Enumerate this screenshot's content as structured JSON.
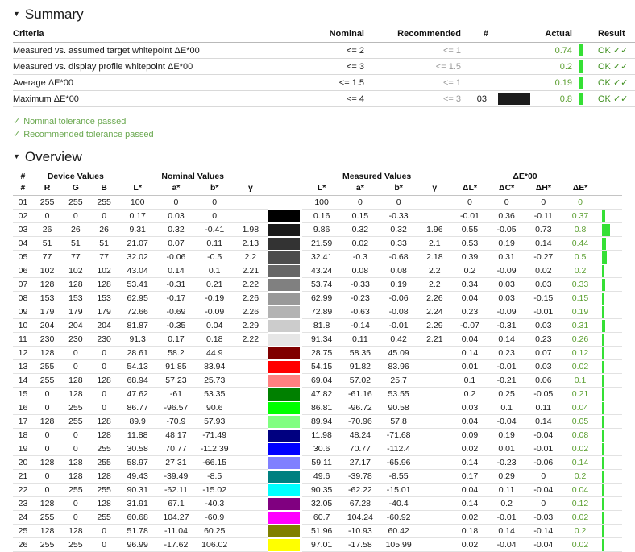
{
  "summary": {
    "heading": "Summary",
    "triangle": "▼",
    "columns": [
      "Criteria",
      "Nominal",
      "Recommended",
      "#",
      "",
      "Actual",
      "",
      "Result"
    ],
    "rows": [
      {
        "criteria": "Measured vs. assumed target whitepoint ΔE*00",
        "nominal": "<= 2",
        "recommended": "<= 1",
        "num": "",
        "swatch": "",
        "actual": "0.74",
        "bar": true,
        "result": "OK ✓✓"
      },
      {
        "criteria": "Measured vs. display profile whitepoint ΔE*00",
        "nominal": "<= 3",
        "recommended": "<= 1.5",
        "num": "",
        "swatch": "",
        "actual": "0.2",
        "bar": true,
        "result": "OK ✓✓"
      },
      {
        "criteria": "Average ΔE*00",
        "nominal": "<= 1.5",
        "recommended": "<= 1",
        "num": "",
        "swatch": "",
        "actual": "0.19",
        "bar": true,
        "result": "OK ✓✓"
      },
      {
        "criteria": "Maximum ΔE*00",
        "nominal": "<= 4",
        "recommended": "<= 3",
        "num": "03",
        "swatch": "#1c1c1c",
        "actual": "0.8",
        "bar": true,
        "result": "OK ✓✓"
      }
    ]
  },
  "notes": [
    {
      "check": "✓",
      "text": "Nominal tolerance passed"
    },
    {
      "check": "✓",
      "text": "Recommended tolerance passed"
    }
  ],
  "overview": {
    "heading": "Overview",
    "triangle": "▼",
    "group_headers": [
      "#",
      "Device Values",
      "Nominal Values",
      "",
      "Measured Values",
      "ΔE*00"
    ],
    "columns": [
      "#",
      "R",
      "G",
      "B",
      "L*",
      "a*",
      "b*",
      "γ",
      "",
      "L*",
      "a*",
      "b*",
      "γ",
      "ΔL*",
      "ΔC*",
      "ΔH*",
      "ΔE*",
      ""
    ],
    "rows": [
      {
        "idx": "01",
        "R": "255",
        "G": "255",
        "B": "255",
        "nL": "100",
        "na": "0",
        "nb": "0",
        "ng": "",
        "swatch": "",
        "mL": "100",
        "ma": "0",
        "mb": "0",
        "mg": "",
        "dL": "0",
        "dC": "0",
        "dH": "0",
        "dE": "0",
        "bar": 0
      },
      {
        "idx": "02",
        "R": "0",
        "G": "0",
        "B": "0",
        "nL": "0.17",
        "na": "0.03",
        "nb": "0",
        "ng": "",
        "swatch": "#000000",
        "mL": "0.16",
        "ma": "0.15",
        "mb": "-0.33",
        "mg": "",
        "dL": "-0.01",
        "dC": "0.36",
        "dH": "-0.11",
        "dE": "0.37",
        "bar": 0.37
      },
      {
        "idx": "03",
        "R": "26",
        "G": "26",
        "B": "26",
        "nL": "9.31",
        "na": "0.32",
        "nb": "-0.41",
        "ng": "1.98",
        "swatch": "#1a1a1a",
        "mL": "9.86",
        "ma": "0.32",
        "mb": "0.32",
        "mg": "1.96",
        "dL": "0.55",
        "dC": "-0.05",
        "dH": "0.73",
        "dE": "0.8",
        "bar": 0.8
      },
      {
        "idx": "04",
        "R": "51",
        "G": "51",
        "B": "51",
        "nL": "21.07",
        "na": "0.07",
        "nb": "0.11",
        "ng": "2.13",
        "swatch": "#333333",
        "mL": "21.59",
        "ma": "0.02",
        "mb": "0.33",
        "mg": "2.1",
        "dL": "0.53",
        "dC": "0.19",
        "dH": "0.14",
        "dE": "0.44",
        "bar": 0.44
      },
      {
        "idx": "05",
        "R": "77",
        "G": "77",
        "B": "77",
        "nL": "32.02",
        "na": "-0.06",
        "nb": "-0.5",
        "ng": "2.2",
        "swatch": "#4d4d4d",
        "mL": "32.41",
        "ma": "-0.3",
        "mb": "-0.68",
        "mg": "2.18",
        "dL": "0.39",
        "dC": "0.31",
        "dH": "-0.27",
        "dE": "0.5",
        "bar": 0.5
      },
      {
        "idx": "06",
        "R": "102",
        "G": "102",
        "B": "102",
        "nL": "43.04",
        "na": "0.14",
        "nb": "0.1",
        "ng": "2.21",
        "swatch": "#666666",
        "mL": "43.24",
        "ma": "0.08",
        "mb": "0.08",
        "mg": "2.2",
        "dL": "0.2",
        "dC": "-0.09",
        "dH": "0.02",
        "dE": "0.2",
        "bar": 0.2
      },
      {
        "idx": "07",
        "R": "128",
        "G": "128",
        "B": "128",
        "nL": "53.41",
        "na": "-0.31",
        "nb": "0.21",
        "ng": "2.22",
        "swatch": "#808080",
        "mL": "53.74",
        "ma": "-0.33",
        "mb": "0.19",
        "mg": "2.2",
        "dL": "0.34",
        "dC": "0.03",
        "dH": "0.03",
        "dE": "0.33",
        "bar": 0.33
      },
      {
        "idx": "08",
        "R": "153",
        "G": "153",
        "B": "153",
        "nL": "62.95",
        "na": "-0.17",
        "nb": "-0.19",
        "ng": "2.26",
        "swatch": "#999999",
        "mL": "62.99",
        "ma": "-0.23",
        "mb": "-0.06",
        "mg": "2.26",
        "dL": "0.04",
        "dC": "0.03",
        "dH": "-0.15",
        "dE": "0.15",
        "bar": 0.15
      },
      {
        "idx": "09",
        "R": "179",
        "G": "179",
        "B": "179",
        "nL": "72.66",
        "na": "-0.69",
        "nb": "-0.09",
        "ng": "2.26",
        "swatch": "#b3b3b3",
        "mL": "72.89",
        "ma": "-0.63",
        "mb": "-0.08",
        "mg": "2.24",
        "dL": "0.23",
        "dC": "-0.09",
        "dH": "-0.01",
        "dE": "0.19",
        "bar": 0.19
      },
      {
        "idx": "10",
        "R": "204",
        "G": "204",
        "B": "204",
        "nL": "81.87",
        "na": "-0.35",
        "nb": "0.04",
        "ng": "2.29",
        "swatch": "#cccccc",
        "mL": "81.8",
        "ma": "-0.14",
        "mb": "-0.01",
        "mg": "2.29",
        "dL": "-0.07",
        "dC": "-0.31",
        "dH": "0.03",
        "dE": "0.31",
        "bar": 0.31
      },
      {
        "idx": "11",
        "R": "230",
        "G": "230",
        "B": "230",
        "nL": "91.3",
        "na": "0.17",
        "nb": "0.18",
        "ng": "2.22",
        "swatch": "#e6e6e6",
        "mL": "91.34",
        "ma": "0.11",
        "mb": "0.42",
        "mg": "2.21",
        "dL": "0.04",
        "dC": "0.14",
        "dH": "0.23",
        "dE": "0.26",
        "bar": 0.26
      },
      {
        "idx": "12",
        "R": "128",
        "G": "0",
        "B": "0",
        "nL": "28.61",
        "na": "58.2",
        "nb": "44.9",
        "ng": "",
        "swatch": "#800000",
        "mL": "28.75",
        "ma": "58.35",
        "mb": "45.09",
        "mg": "",
        "dL": "0.14",
        "dC": "0.23",
        "dH": "0.07",
        "dE": "0.12",
        "bar": 0.12
      },
      {
        "idx": "13",
        "R": "255",
        "G": "0",
        "B": "0",
        "nL": "54.13",
        "na": "91.85",
        "nb": "83.94",
        "ng": "",
        "swatch": "#ff0000",
        "mL": "54.15",
        "ma": "91.82",
        "mb": "83.96",
        "mg": "",
        "dL": "0.01",
        "dC": "-0.01",
        "dH": "0.03",
        "dE": "0.02",
        "bar": 0.02
      },
      {
        "idx": "14",
        "R": "255",
        "G": "128",
        "B": "128",
        "nL": "68.94",
        "na": "57.23",
        "nb": "25.73",
        "ng": "",
        "swatch": "#ff8080",
        "mL": "69.04",
        "ma": "57.02",
        "mb": "25.7",
        "mg": "",
        "dL": "0.1",
        "dC": "-0.21",
        "dH": "0.06",
        "dE": "0.1",
        "bar": 0.1
      },
      {
        "idx": "15",
        "R": "0",
        "G": "128",
        "B": "0",
        "nL": "47.62",
        "na": "-61",
        "nb": "53.35",
        "ng": "",
        "swatch": "#008000",
        "mL": "47.82",
        "ma": "-61.16",
        "mb": "53.55",
        "mg": "",
        "dL": "0.2",
        "dC": "0.25",
        "dH": "-0.05",
        "dE": "0.21",
        "bar": 0.21
      },
      {
        "idx": "16",
        "R": "0",
        "G": "255",
        "B": "0",
        "nL": "86.77",
        "na": "-96.57",
        "nb": "90.6",
        "ng": "",
        "swatch": "#00ff00",
        "mL": "86.81",
        "ma": "-96.72",
        "mb": "90.58",
        "mg": "",
        "dL": "0.03",
        "dC": "0.1",
        "dH": "0.11",
        "dE": "0.04",
        "bar": 0.04
      },
      {
        "idx": "17",
        "R": "128",
        "G": "255",
        "B": "128",
        "nL": "89.9",
        "na": "-70.9",
        "nb": "57.93",
        "ng": "",
        "swatch": "#80ff80",
        "mL": "89.94",
        "ma": "-70.96",
        "mb": "57.8",
        "mg": "",
        "dL": "0.04",
        "dC": "-0.04",
        "dH": "0.14",
        "dE": "0.05",
        "bar": 0.05
      },
      {
        "idx": "18",
        "R": "0",
        "G": "0",
        "B": "128",
        "nL": "11.88",
        "na": "48.17",
        "nb": "-71.49",
        "ng": "",
        "swatch": "#000080",
        "mL": "11.98",
        "ma": "48.24",
        "mb": "-71.68",
        "mg": "",
        "dL": "0.09",
        "dC": "0.19",
        "dH": "-0.04",
        "dE": "0.08",
        "bar": 0.08
      },
      {
        "idx": "19",
        "R": "0",
        "G": "0",
        "B": "255",
        "nL": "30.58",
        "na": "70.77",
        "nb": "-112.39",
        "ng": "",
        "swatch": "#0000ff",
        "mL": "30.6",
        "ma": "70.77",
        "mb": "-112.4",
        "mg": "",
        "dL": "0.02",
        "dC": "0.01",
        "dH": "-0.01",
        "dE": "0.02",
        "bar": 0.02
      },
      {
        "idx": "20",
        "R": "128",
        "G": "128",
        "B": "255",
        "nL": "58.97",
        "na": "27.31",
        "nb": "-66.15",
        "ng": "",
        "swatch": "#8080ff",
        "mL": "59.11",
        "ma": "27.17",
        "mb": "-65.96",
        "mg": "",
        "dL": "0.14",
        "dC": "-0.23",
        "dH": "-0.06",
        "dE": "0.14",
        "bar": 0.14
      },
      {
        "idx": "21",
        "R": "0",
        "G": "128",
        "B": "128",
        "nL": "49.43",
        "na": "-39.49",
        "nb": "-8.5",
        "ng": "",
        "swatch": "#008080",
        "mL": "49.6",
        "ma": "-39.78",
        "mb": "-8.55",
        "mg": "",
        "dL": "0.17",
        "dC": "0.29",
        "dH": "0",
        "dE": "0.2",
        "bar": 0.2
      },
      {
        "idx": "22",
        "R": "0",
        "G": "255",
        "B": "255",
        "nL": "90.31",
        "na": "-62.11",
        "nb": "-15.02",
        "ng": "",
        "swatch": "#00ffff",
        "mL": "90.35",
        "ma": "-62.22",
        "mb": "-15.01",
        "mg": "",
        "dL": "0.04",
        "dC": "0.11",
        "dH": "-0.04",
        "dE": "0.04",
        "bar": 0.04
      },
      {
        "idx": "23",
        "R": "128",
        "G": "0",
        "B": "128",
        "nL": "31.91",
        "na": "67.1",
        "nb": "-40.3",
        "ng": "",
        "swatch": "#800080",
        "mL": "32.05",
        "ma": "67.28",
        "mb": "-40.4",
        "mg": "",
        "dL": "0.14",
        "dC": "0.2",
        "dH": "0",
        "dE": "0.12",
        "bar": 0.12
      },
      {
        "idx": "24",
        "R": "255",
        "G": "0",
        "B": "255",
        "nL": "60.68",
        "na": "104.27",
        "nb": "-60.9",
        "ng": "",
        "swatch": "#ff00ff",
        "mL": "60.7",
        "ma": "104.24",
        "mb": "-60.92",
        "mg": "",
        "dL": "0.02",
        "dC": "-0.01",
        "dH": "-0.03",
        "dE": "0.02",
        "bar": 0.02
      },
      {
        "idx": "25",
        "R": "128",
        "G": "128",
        "B": "0",
        "nL": "51.78",
        "na": "-11.04",
        "nb": "60.25",
        "ng": "",
        "swatch": "#808000",
        "mL": "51.96",
        "ma": "-10.93",
        "mb": "60.42",
        "mg": "",
        "dL": "0.18",
        "dC": "0.14",
        "dH": "-0.14",
        "dE": "0.2",
        "bar": 0.2
      },
      {
        "idx": "26",
        "R": "255",
        "G": "255",
        "B": "0",
        "nL": "96.99",
        "na": "-17.62",
        "nb": "106.02",
        "ng": "",
        "swatch": "#ffff00",
        "mL": "97.01",
        "ma": "-17.58",
        "mb": "105.99",
        "mg": "",
        "dL": "0.02",
        "dC": "-0.04",
        "dH": "-0.04",
        "dE": "0.02",
        "bar": 0.02
      }
    ]
  },
  "colors": {
    "bar_green": "#35e035",
    "pass_green": "#6aa84f",
    "value_green": "#5a9e2f",
    "muted": "#9a9a9a"
  }
}
